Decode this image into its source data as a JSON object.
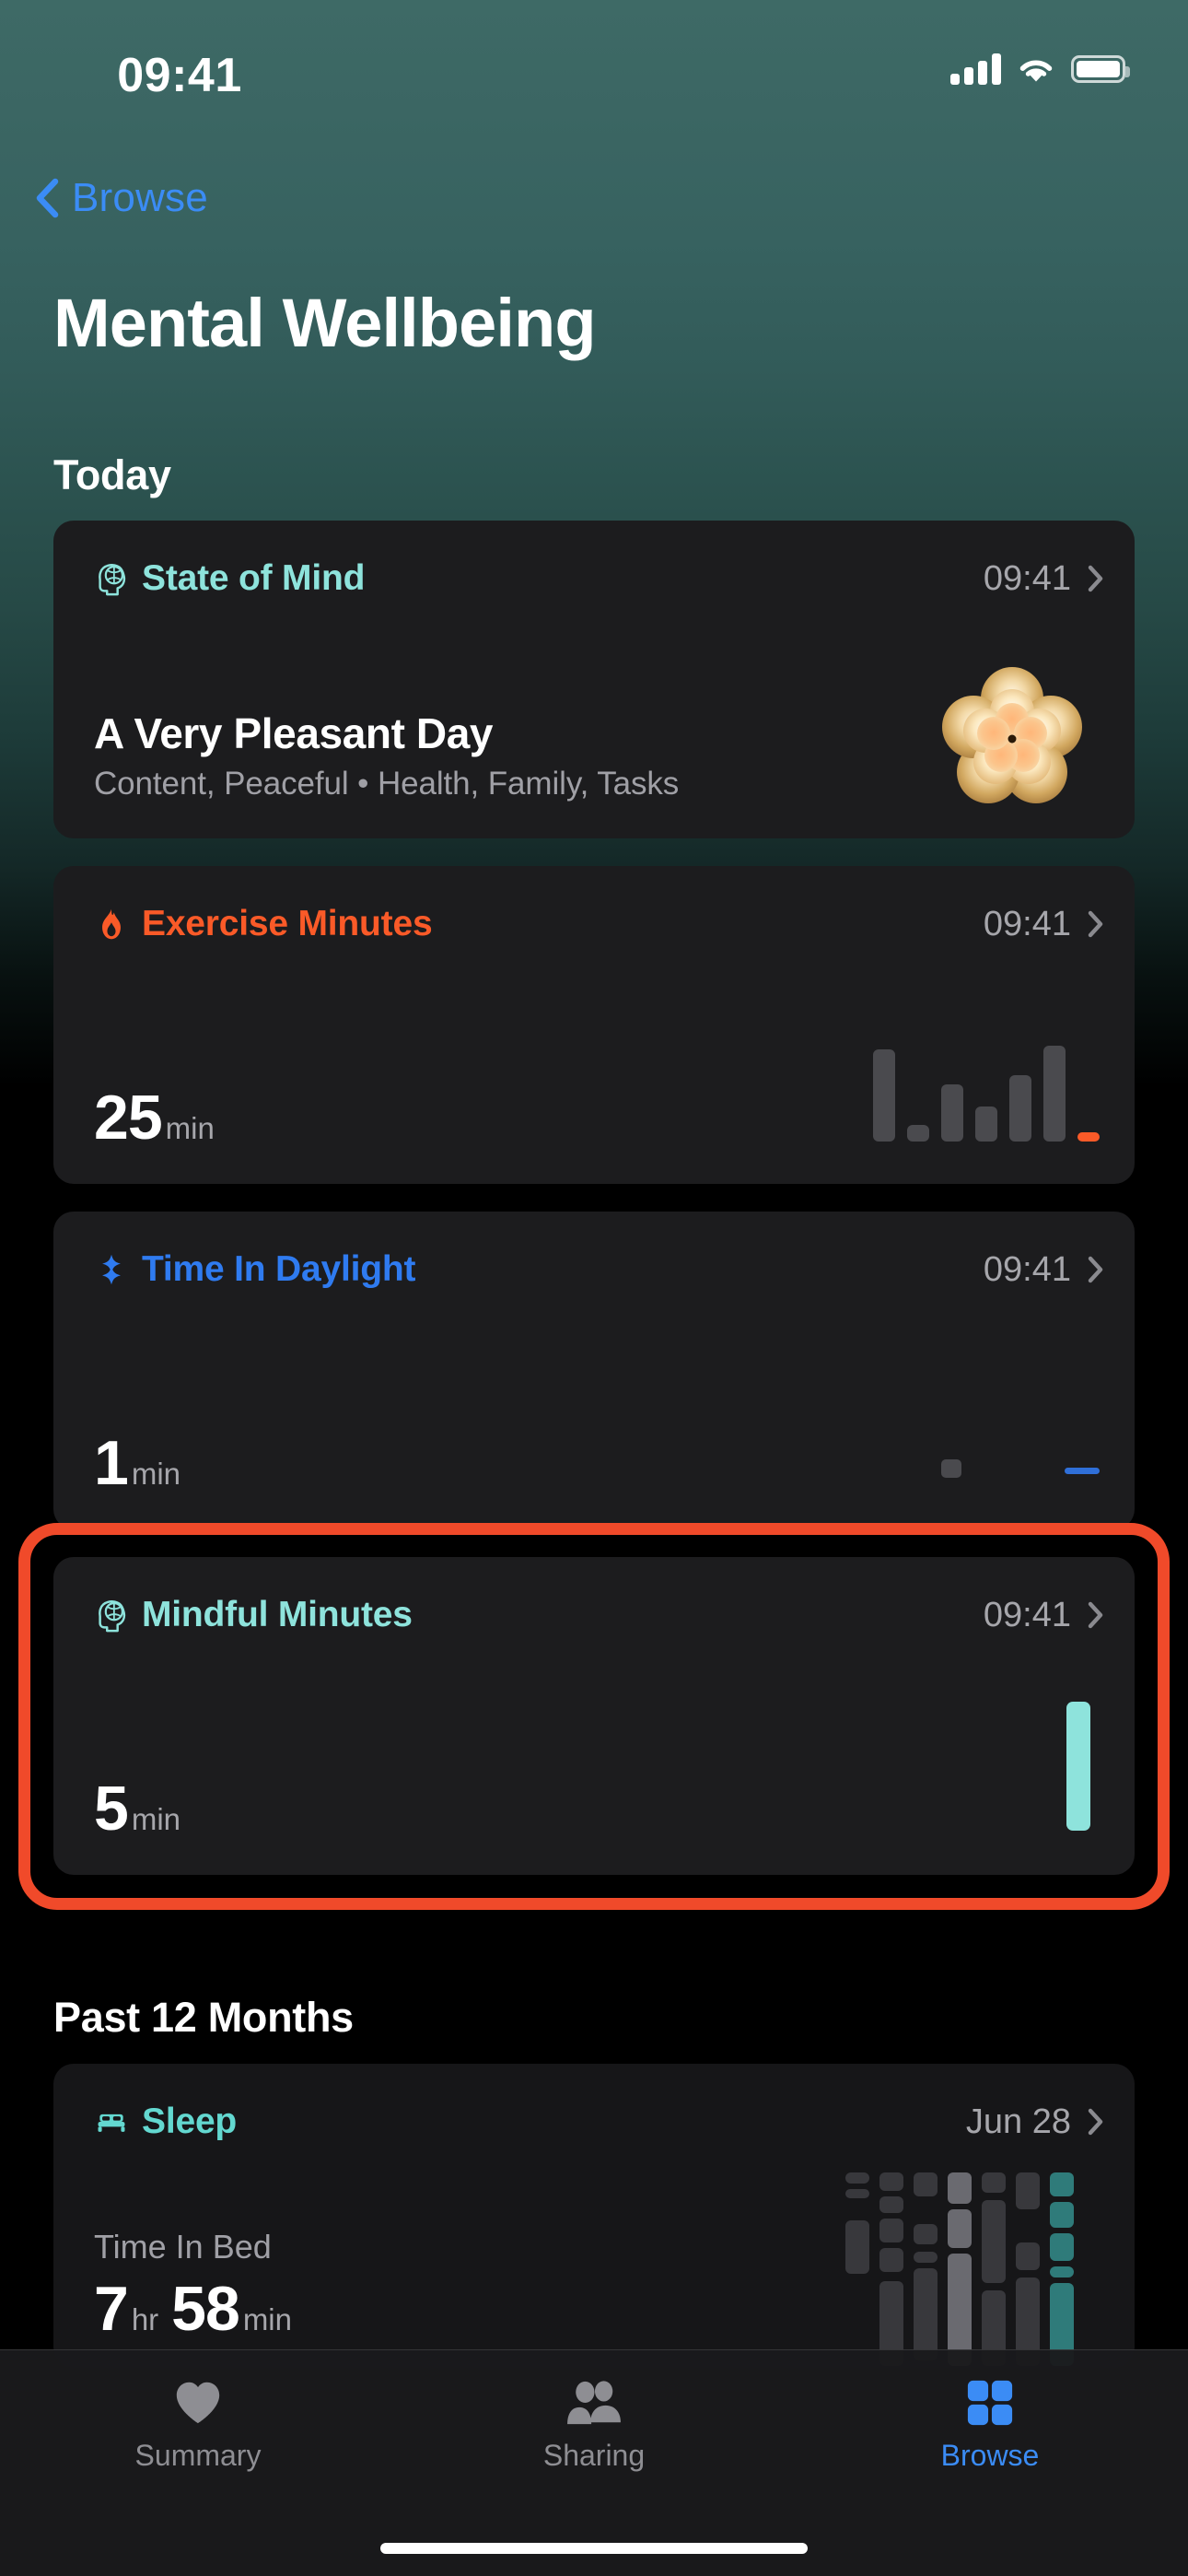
{
  "status_bar": {
    "time": "09:41",
    "signal_icon": "cellular-signal-icon",
    "wifi_icon": "wifi-icon",
    "battery_icon": "battery-icon"
  },
  "nav": {
    "back_label": "Browse",
    "back_icon": "chevron-left-icon"
  },
  "header": {
    "title": "Mental Wellbeing"
  },
  "sections": {
    "today": "Today",
    "past_12_months": "Past 12 Months"
  },
  "colors": {
    "state_of_mind": "#8ee3dc",
    "exercise": "#fa5a28",
    "daylight": "#2f7bf0",
    "mindful": "#8ee3dc",
    "sleep": "#63d8d0",
    "accent_blue": "#3b8cf5",
    "highlight_ring": "#f04a2a",
    "card_bg": "#1c1c1e",
    "muted_text": "#a6a6ab"
  },
  "cards": {
    "state_of_mind": {
      "icon": "head-brain-icon",
      "title": "State of Mind",
      "time": "09:41",
      "chevron": "chevron-right-icon",
      "headline": "A Very Pleasant Day",
      "subtitle": "Content, Peaceful • Health, Family, Tasks",
      "graphic": "flower-bloom-icon"
    },
    "exercise": {
      "icon": "flame-icon",
      "title": "Exercise Minutes",
      "time": "09:41",
      "chevron": "chevron-right-icon",
      "value": "25",
      "unit": "min"
    },
    "daylight": {
      "icon": "daylight-cross-icon",
      "title": "Time In Daylight",
      "time": "09:41",
      "chevron": "chevron-right-icon",
      "value": "1",
      "unit": "min"
    },
    "mindful": {
      "icon": "head-brain-icon",
      "title": "Mindful Minutes",
      "time": "09:41",
      "chevron": "chevron-right-icon",
      "value": "5",
      "unit": "min",
      "highlighted": true
    },
    "sleep": {
      "icon": "bed-icon",
      "title": "Sleep",
      "date": "Jun 28",
      "chevron": "chevron-right-icon",
      "metric_label": "Time In Bed",
      "hours": "7",
      "hours_unit": "hr",
      "minutes": "58",
      "minutes_unit": "min"
    }
  },
  "chart_data": [
    {
      "type": "bar",
      "title": "Exercise Minutes",
      "categories": [
        "1",
        "2",
        "3",
        "4",
        "5",
        "6",
        "7"
      ],
      "values": [
        100,
        18,
        62,
        38,
        72,
        104,
        10
      ],
      "ylabel": "min",
      "xlabel": "",
      "ylim": [
        0,
        110
      ],
      "highlight_index": 6,
      "highlight_color": "#fa5a28",
      "bar_color": "#4a4a4e",
      "grid": false,
      "legend": "none"
    },
    {
      "type": "bar",
      "title": "Time In Daylight",
      "categories": [
        "1",
        "2"
      ],
      "values": [
        20,
        7
      ],
      "ylabel": "min",
      "xlabel": "",
      "ylim": [
        0,
        30
      ],
      "highlight_index": 1,
      "highlight_color": "#2f6fd8",
      "bar_color": "#4a4a4e",
      "grid": false,
      "legend": "none"
    },
    {
      "type": "bar",
      "title": "Mindful Minutes",
      "categories": [
        "1"
      ],
      "values": [
        140
      ],
      "ylabel": "min",
      "xlabel": "",
      "ylim": [
        0,
        150
      ],
      "bar_color": "#8ee3dc",
      "grid": false,
      "legend": "none"
    },
    {
      "type": "bar",
      "title": "Sleep - Time In Bed",
      "categories": [
        "1",
        "2",
        "3",
        "4",
        "5",
        "6",
        "7"
      ],
      "series": [
        {
          "name": "segments",
          "values": [
            [
              [
                0,
                12
              ],
              [
                18,
                10
              ],
              [
                52,
                58
              ]
            ],
            [
              [
                0,
                20
              ],
              [
                26,
                18
              ],
              [
                50,
                26
              ],
              [
                82,
                26
              ],
              [
                118,
                92
              ]
            ],
            [
              [
                0,
                26
              ],
              [
                56,
                22
              ],
              [
                86,
                12
              ],
              [
                104,
                100
              ]
            ],
            [
              [
                0,
                34
              ],
              [
                40,
                42
              ],
              [
                88,
                122
              ]
            ],
            [
              [
                0,
                22
              ],
              [
                30,
                90
              ],
              [
                128,
                82
              ]
            ],
            [
              [
                0,
                40
              ],
              [
                76,
                30
              ],
              [
                114,
                96
              ]
            ],
            [
              [
                0,
                26
              ],
              [
                32,
                28
              ],
              [
                66,
                30
              ],
              [
                102,
                12
              ],
              [
                120,
                90
              ]
            ]
          ]
        }
      ],
      "ylim": [
        0,
        212
      ],
      "bar_color": "#38383c",
      "highlight_index": 6,
      "highlight_color": "#2f7b7a",
      "grid": false,
      "legend": "none"
    }
  ],
  "tabbar": {
    "items": [
      {
        "label": "Summary",
        "icon": "heart-icon",
        "active": false
      },
      {
        "label": "Sharing",
        "icon": "people-icon",
        "active": false
      },
      {
        "label": "Browse",
        "icon": "grid-squares-icon",
        "active": true
      }
    ]
  }
}
